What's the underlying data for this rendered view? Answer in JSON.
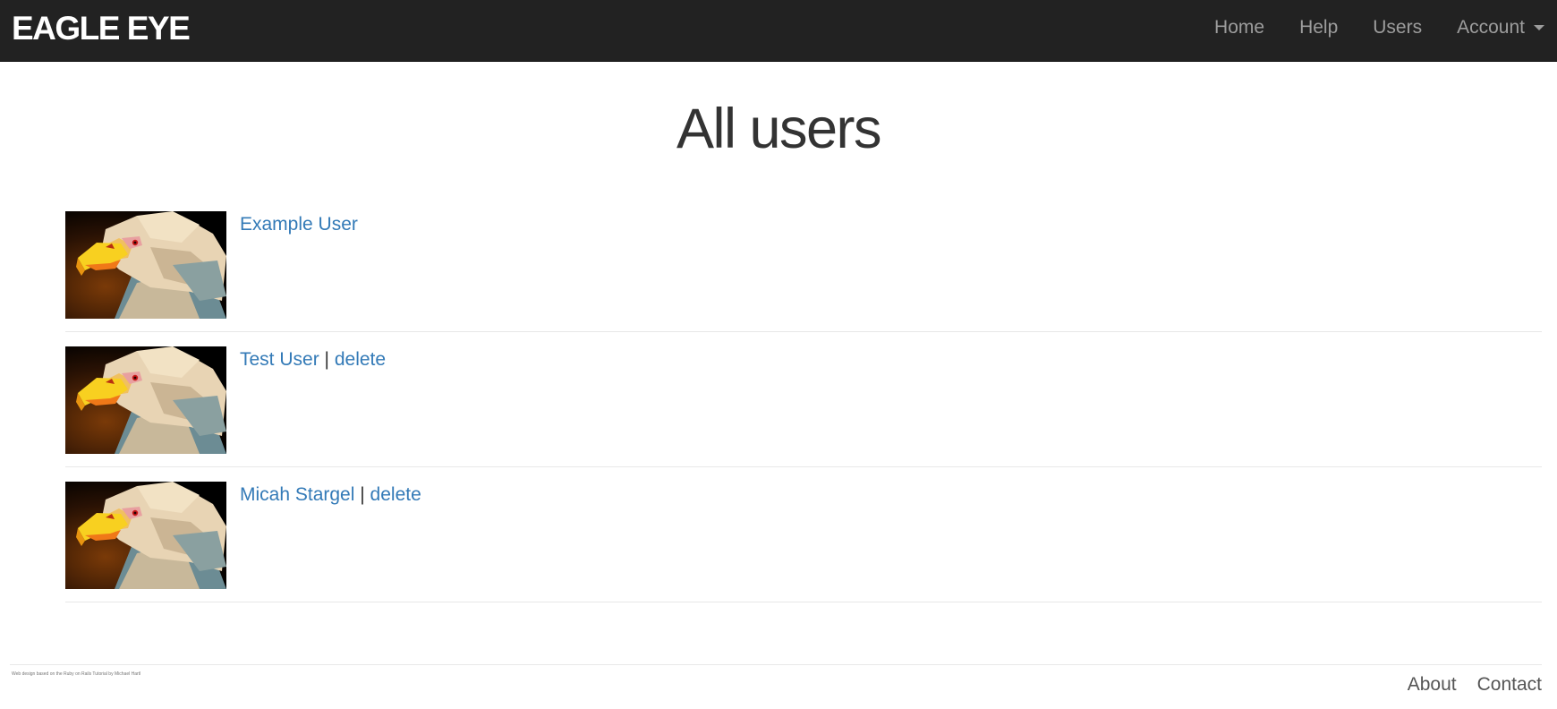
{
  "header": {
    "logo": "EAGLE EYE",
    "nav": {
      "home": "Home",
      "help": "Help",
      "users": "Users",
      "account": "Account"
    }
  },
  "page": {
    "title": "All users"
  },
  "users": [
    {
      "name": "Example User",
      "delete_label": ""
    },
    {
      "name": "Test User",
      "separator": "|",
      "delete_label": "delete"
    },
    {
      "name": "Micah Stargel",
      "separator": "|",
      "delete_label": "delete"
    }
  ],
  "footer": {
    "credit": "Web design based on the Ruby on Rails Tutorial by Michael Hartl",
    "about": "About",
    "contact": "Contact"
  }
}
